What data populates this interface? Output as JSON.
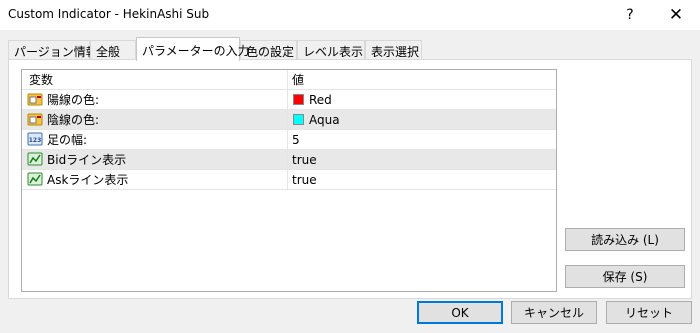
{
  "window": {
    "title": "Custom Indicator - HekinAshi Sub",
    "help_label": "?",
    "close_label": "✕"
  },
  "tabs": [
    {
      "label": "パージョン情報",
      "active": false
    },
    {
      "label": "全般",
      "active": false
    },
    {
      "label": "パラメーターの入力",
      "active": true
    },
    {
      "label": "色の設定",
      "active": false
    },
    {
      "label": "レベル表示",
      "active": false
    },
    {
      "label": "表示選択",
      "active": false
    }
  ],
  "grid": {
    "columns": [
      "変数",
      "値"
    ],
    "rows": [
      {
        "name": "陽線の色:",
        "value": "Red",
        "icon": "color-param-icon",
        "swatch_color": "#ff0000"
      },
      {
        "name": "陰線の色:",
        "value": "Aqua",
        "icon": "color-param-icon",
        "swatch_color": "#00ffff"
      },
      {
        "name": "足の幅:",
        "value": "5",
        "icon": "integer-param-icon",
        "swatch_color": null
      },
      {
        "name": "Bidライン表示",
        "value": "true",
        "icon": "boolean-param-icon",
        "swatch_color": null
      },
      {
        "name": "Askライン表示",
        "value": "true",
        "icon": "boolean-param-icon",
        "swatch_color": null
      }
    ]
  },
  "side_buttons": {
    "load_label": "読み込み (L)",
    "save_label": "保存 (S)"
  },
  "footer": {
    "ok_label": "OK",
    "cancel_label": "キャンセル",
    "reset_label": "リセット"
  },
  "colors": {
    "accent": "#0078d7",
    "row_shade": "#e8e8e8"
  }
}
